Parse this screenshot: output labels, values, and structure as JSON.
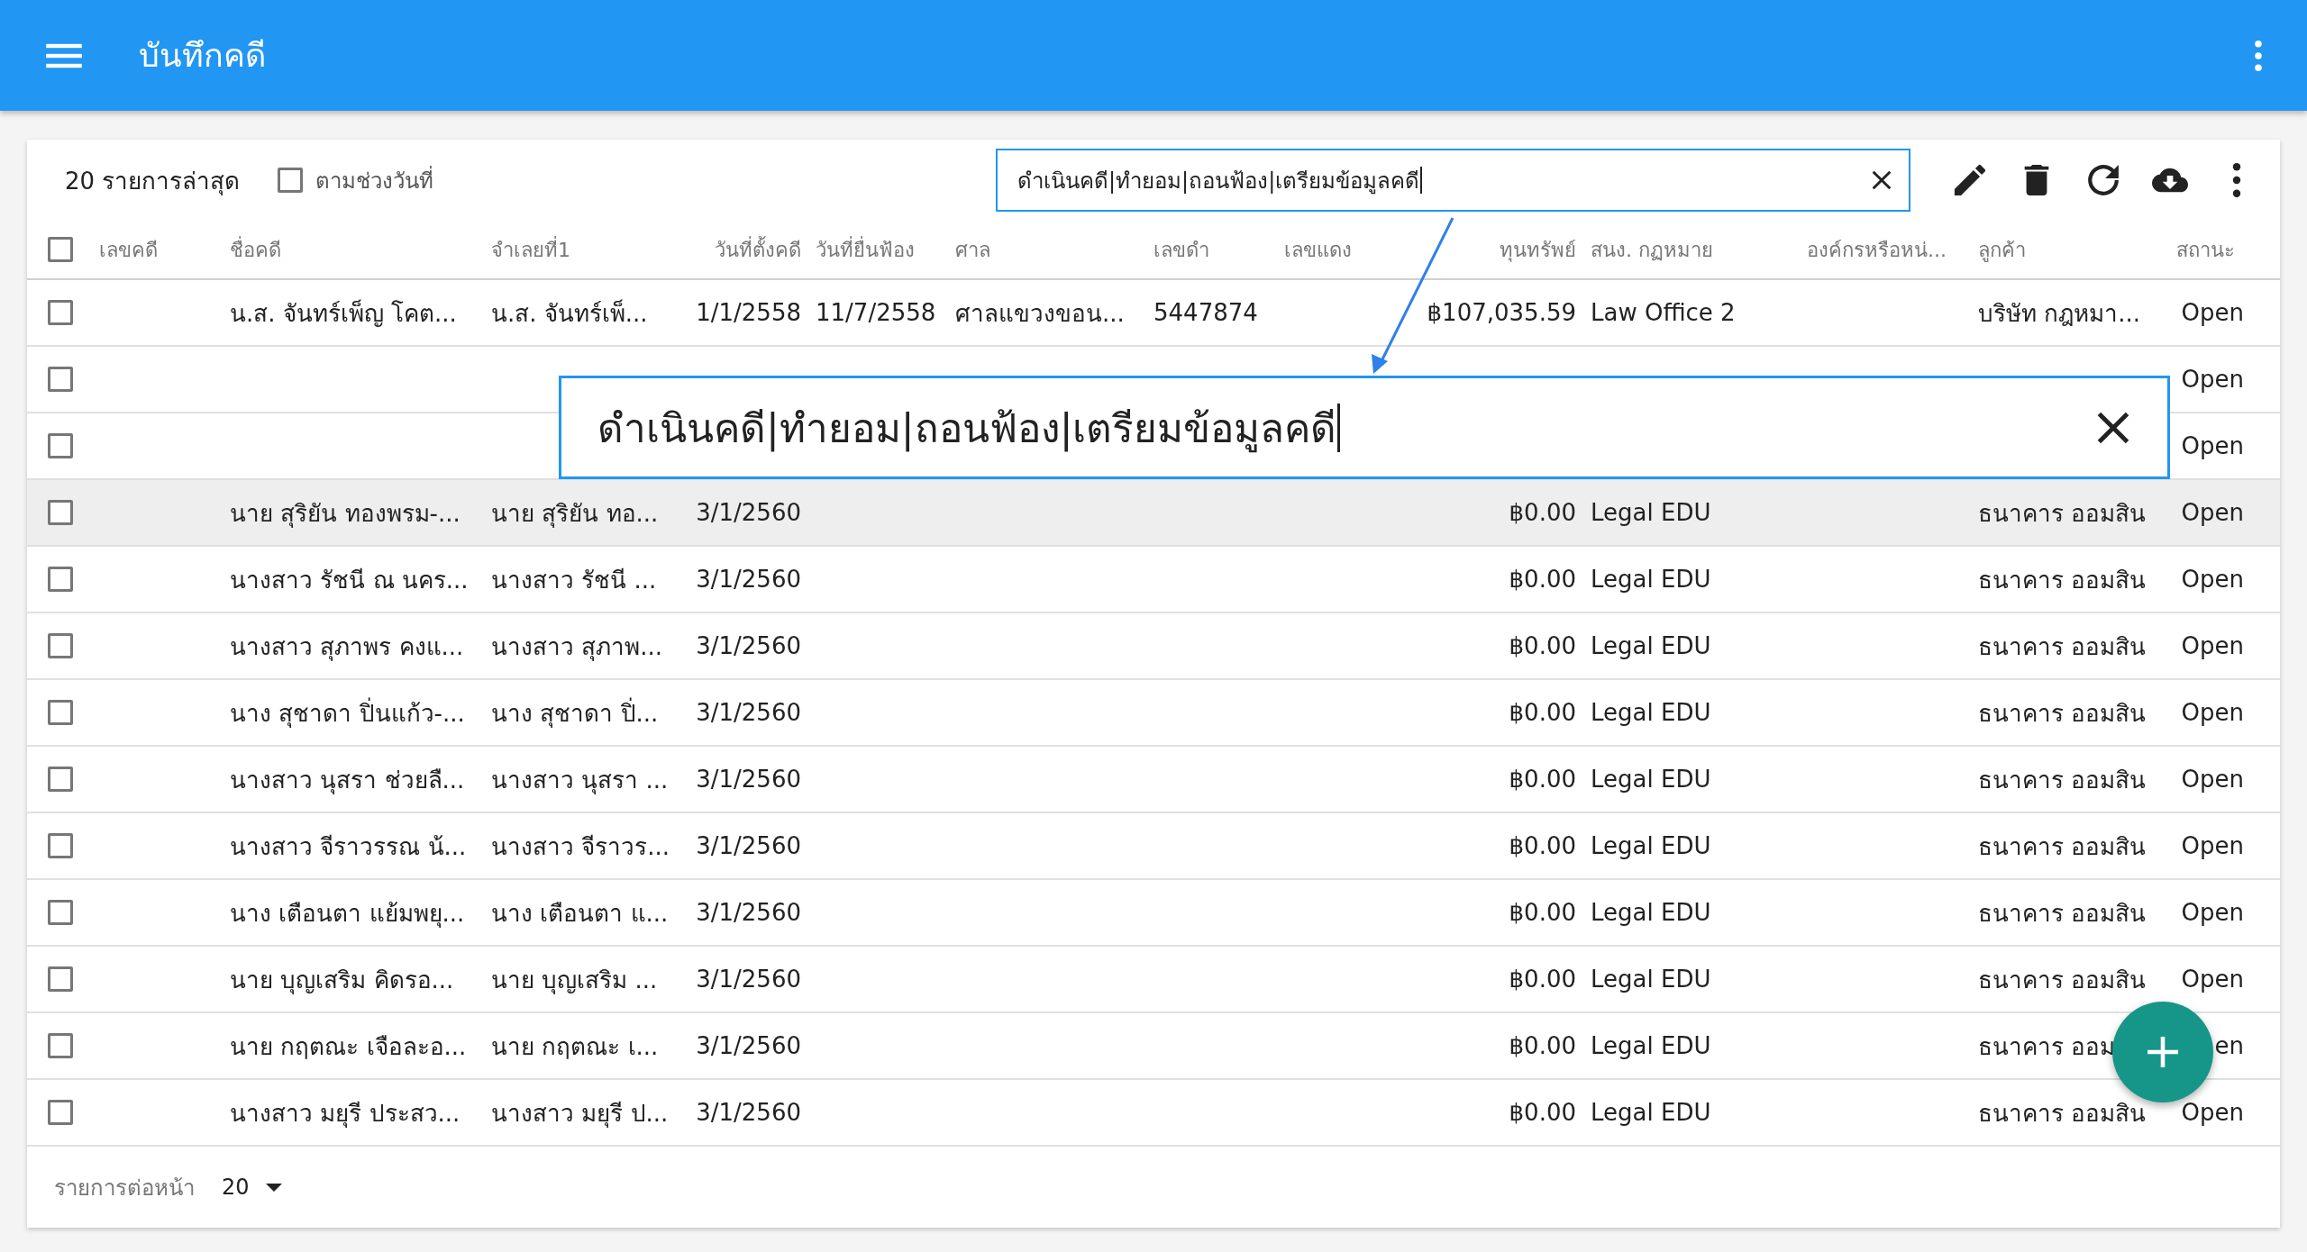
{
  "app_bar": {
    "title": "บันทึกคดี"
  },
  "toolbar": {
    "recent_label": "20 รายการล่าสุด",
    "date_range": {
      "label": "ตามช่วงวันที่",
      "checked": false
    },
    "search": {
      "value": "ดำเนินคดี|ทำยอม|ถอนฟ้อง|เตรียมข้อมูลคดี"
    }
  },
  "table": {
    "select_all": {
      "checked": false
    },
    "columns": [
      "เลขคดี",
      "ชื่อคดี",
      "จำเลยที่1",
      "วันที่ตั้งคดี",
      "วันที่ยื่นฟ้อง",
      "ศาล",
      "เลขดำ",
      "เลขแดง",
      "ทุนทรัพย์",
      "สนง. กฏหมาย",
      "องค์กรหรือหน่...",
      "ลูกค้า",
      "สถานะ"
    ],
    "rows": [
      {
        "selected": false,
        "hovered": false,
        "case_name": "น.ส. จันทร์เพ็ญ โคต...",
        "defendant_1": "น.ส. จันทร์เพ็...",
        "filed_date": "1/1/2558",
        "sued_date": "11/7/2558",
        "court": "ศาลแขวงขอน...",
        "black_no": "5447874",
        "capital": "฿107,035.59",
        "law_office": "Law Office 2",
        "client": "บริษัท กฎหมา...",
        "status": "Open"
      },
      {
        "selected": false,
        "hovered": false,
        "status": "Open"
      },
      {
        "selected": false,
        "hovered": false,
        "status": "Open"
      },
      {
        "selected": false,
        "hovered": true,
        "case_name": "นาย สุริยัน ทองพรม-...",
        "defendant_1": "นาย สุริยัน ทอ...",
        "filed_date": "3/1/2560",
        "capital": "฿0.00",
        "law_office": "Legal EDU",
        "client": "ธนาคาร ออมสิน",
        "status": "Open"
      },
      {
        "selected": false,
        "hovered": false,
        "case_name": "นางสาว รัชนี ณ นคร...",
        "defendant_1": "นางสาว รัชนี ...",
        "filed_date": "3/1/2560",
        "capital": "฿0.00",
        "law_office": "Legal EDU",
        "client": "ธนาคาร ออมสิน",
        "status": "Open"
      },
      {
        "selected": false,
        "hovered": false,
        "case_name": "นางสาว สุภาพร คงแ...",
        "defendant_1": "นางสาว สุภาพ...",
        "filed_date": "3/1/2560",
        "capital": "฿0.00",
        "law_office": "Legal EDU",
        "client": "ธนาคาร ออมสิน",
        "status": "Open"
      },
      {
        "selected": false,
        "hovered": false,
        "case_name": "นาง สุชาดา ปิ่นแก้ว-...",
        "defendant_1": "นาง สุชาดา ปิ่...",
        "filed_date": "3/1/2560",
        "capital": "฿0.00",
        "law_office": "Legal EDU",
        "client": "ธนาคาร ออมสิน",
        "status": "Open"
      },
      {
        "selected": false,
        "hovered": false,
        "case_name": "นางสาว นุสรา ช่วยลื...",
        "defendant_1": "นางสาว นุสรา ...",
        "filed_date": "3/1/2560",
        "capital": "฿0.00",
        "law_office": "Legal EDU",
        "client": "ธนาคาร ออมสิน",
        "status": "Open"
      },
      {
        "selected": false,
        "hovered": false,
        "case_name": "นางสาว จีราวรรณ น้...",
        "defendant_1": "นางสาว จีราวร...",
        "filed_date": "3/1/2560",
        "capital": "฿0.00",
        "law_office": "Legal EDU",
        "client": "ธนาคาร ออมสิน",
        "status": "Open"
      },
      {
        "selected": false,
        "hovered": false,
        "case_name": "นาง เตือนตา แย้มพยุ...",
        "defendant_1": "นาง เตือนตา แ...",
        "filed_date": "3/1/2560",
        "capital": "฿0.00",
        "law_office": "Legal EDU",
        "client": "ธนาคาร ออมสิน",
        "status": "Open"
      },
      {
        "selected": false,
        "hovered": false,
        "case_name": "นาย บุญเสริม คิดรอ...",
        "defendant_1": "นาย บุญเสริม ...",
        "filed_date": "3/1/2560",
        "capital": "฿0.00",
        "law_office": "Legal EDU",
        "client": "ธนาคาร ออมสิน",
        "status": "Open"
      },
      {
        "selected": false,
        "hovered": false,
        "case_name": "นาย กฤตณะ เจือละอ...",
        "defendant_1": "นาย กฤตณะ เ...",
        "filed_date": "3/1/2560",
        "capital": "฿0.00",
        "law_office": "Legal EDU",
        "client": "ธนาคาร ออม",
        "status": "en"
      },
      {
        "selected": false,
        "hovered": false,
        "case_name": "นางสาว มยุรี ประสว...",
        "defendant_1": "นางสาว มยุรี ป...",
        "filed_date": "3/1/2560",
        "capital": "฿0.00",
        "law_office": "Legal EDU",
        "client": "ธนาคาร ออมสิน",
        "status": "Open"
      }
    ]
  },
  "callout": {
    "value": "ดำเนินคดี|ทำยอม|ถอนฟ้อง|เตรียมข้อมูลคดี"
  },
  "footer": {
    "label": "รายการต่อหน้า",
    "page_size": "20"
  }
}
